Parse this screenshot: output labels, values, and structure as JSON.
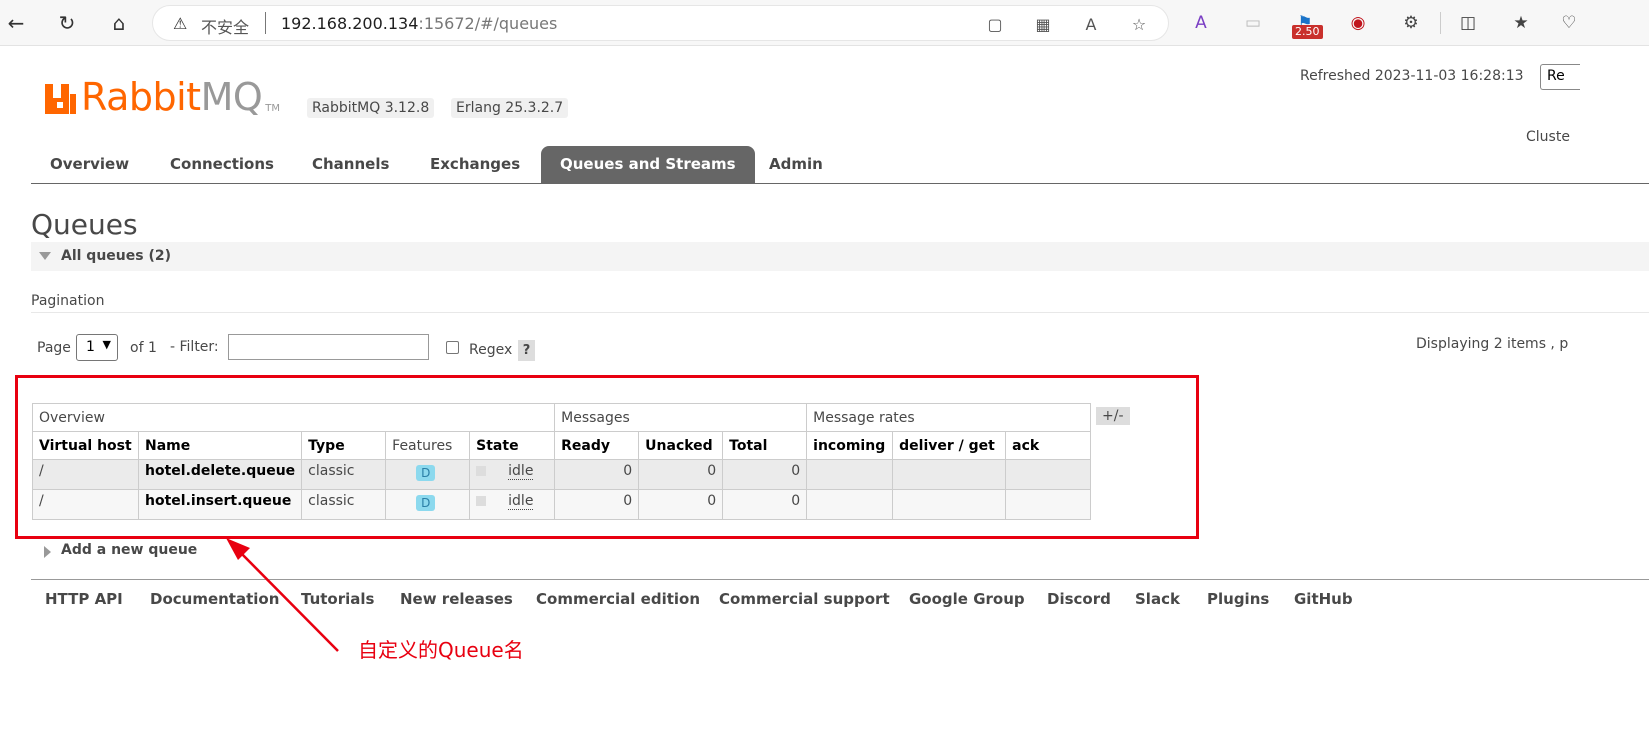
{
  "browser": {
    "insecure_label": "不安全",
    "url_host": "192.168.200.134",
    "url_path": ":15672/#/queues",
    "ext_badge": "2.50"
  },
  "header": {
    "logo_brand": "Rabbit",
    "logo_mq": "MQ",
    "logo_tm": "TM",
    "rabbit_version": "RabbitMQ 3.12.8",
    "erlang_version": "Erlang 25.3.2.7",
    "refreshed": "Refreshed 2023-11-03 16:28:13",
    "refresh_select": "Re",
    "cluster": "Cluste"
  },
  "tabs": [
    "Overview",
    "Connections",
    "Channels",
    "Exchanges",
    "Queues and Streams",
    "Admin"
  ],
  "active_tab": "Queues and Streams",
  "page": {
    "title": "Queues",
    "section_label": "All queues (2)",
    "pagination_heading": "Pagination",
    "page_label": "Page",
    "page_value": "1",
    "of_label": "of 1",
    "filter_label": "- Filter:",
    "filter_value": "",
    "regex_label": "Regex",
    "help_label": "?",
    "displaying": "Displaying 2 items , p"
  },
  "table": {
    "groups": [
      "Overview",
      "Messages",
      "Message rates"
    ],
    "plusminus": "+/-",
    "columns": [
      "Virtual host",
      "Name",
      "Type",
      "Features",
      "State",
      "Ready",
      "Unacked",
      "Total",
      "incoming",
      "deliver / get",
      "ack"
    ],
    "rows": [
      {
        "vhost": "/",
        "name": "hotel.delete.queue",
        "type": "classic",
        "feature": "D",
        "state": "idle",
        "ready": "0",
        "unacked": "0",
        "total": "0",
        "incoming": "",
        "deliver": "",
        "ack": ""
      },
      {
        "vhost": "/",
        "name": "hotel.insert.queue",
        "type": "classic",
        "feature": "D",
        "state": "idle",
        "ready": "0",
        "unacked": "0",
        "total": "0",
        "incoming": "",
        "deliver": "",
        "ack": ""
      }
    ]
  },
  "add_queue": "Add a new queue",
  "footer_links": [
    "HTTP API",
    "Documentation",
    "Tutorials",
    "New releases",
    "Commercial edition",
    "Commercial support",
    "Google Group",
    "Discord",
    "Slack",
    "Plugins",
    "GitHub"
  ],
  "annotation": {
    "text": "自定义的Queue名",
    "color": "#e80010"
  },
  "colors": {
    "brand_orange": "#ff6600",
    "active_tab_bg": "#666666",
    "feature_badge": "#8cd9ee"
  }
}
